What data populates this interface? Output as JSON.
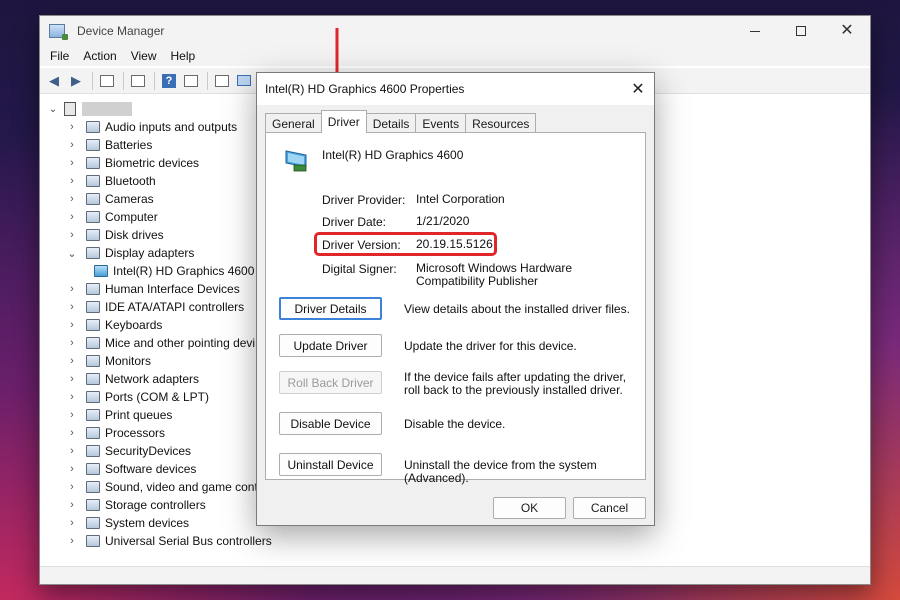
{
  "device_manager": {
    "title": "Device Manager",
    "menu": [
      "File",
      "Action",
      "View",
      "Help"
    ],
    "toolbar_icons": [
      "back-icon",
      "forward-icon",
      "properties-icon",
      "refresh-icon",
      "help-icon",
      "display-icon",
      "update-driver-icon",
      "monitor-icon"
    ],
    "tree": {
      "categories": [
        {
          "label": "Audio inputs and outputs",
          "icon": "speaker-icon"
        },
        {
          "label": "Batteries",
          "icon": "battery-icon"
        },
        {
          "label": "Biometric devices",
          "icon": "fingerprint-icon"
        },
        {
          "label": "Bluetooth",
          "icon": "bluetooth-icon"
        },
        {
          "label": "Cameras",
          "icon": "camera-icon"
        },
        {
          "label": "Computer",
          "icon": "computer-icon"
        },
        {
          "label": "Disk drives",
          "icon": "disk-icon"
        },
        {
          "label": "Display adapters",
          "icon": "display-adapter-icon",
          "expanded": true
        },
        {
          "label": "Human Interface Devices",
          "icon": "hid-icon"
        },
        {
          "label": "IDE ATA/ATAPI controllers",
          "icon": "ide-icon"
        },
        {
          "label": "Keyboards",
          "icon": "keyboard-icon"
        },
        {
          "label": "Mice and other pointing devi",
          "icon": "mouse-icon"
        },
        {
          "label": "Monitors",
          "icon": "monitor-icon"
        },
        {
          "label": "Network adapters",
          "icon": "network-icon"
        },
        {
          "label": "Ports (COM & LPT)",
          "icon": "port-icon"
        },
        {
          "label": "Print queues",
          "icon": "printer-icon"
        },
        {
          "label": "Processors",
          "icon": "cpu-icon"
        },
        {
          "label": "SecurityDevices",
          "icon": "security-icon"
        },
        {
          "label": "Software devices",
          "icon": "software-icon"
        },
        {
          "label": "Sound, video and game cont",
          "icon": "sound-icon"
        },
        {
          "label": "Storage controllers",
          "icon": "storage-icon"
        },
        {
          "label": "System devices",
          "icon": "system-icon"
        },
        {
          "label": "Universal Serial Bus controllers",
          "icon": "usb-icon"
        }
      ],
      "child": "Intel(R) HD Graphics 4600"
    }
  },
  "dialog": {
    "title": "Intel(R) HD Graphics 4600 Properties",
    "tabs": [
      "General",
      "Driver",
      "Details",
      "Events",
      "Resources"
    ],
    "active_tab": "Driver",
    "device_name": "Intel(R) HD Graphics 4600",
    "info": {
      "provider_label": "Driver Provider:",
      "provider_value": "Intel Corporation",
      "date_label": "Driver Date:",
      "date_value": "1/21/2020",
      "version_label": "Driver Version:",
      "version_value": "20.19.15.5126",
      "signer_label": "Digital Signer:",
      "signer_value": "Microsoft Windows Hardware Compatibility Publisher"
    },
    "actions": {
      "details_label": "Driver Details",
      "details_desc": "View details about the installed driver files.",
      "update_label": "Update Driver",
      "update_desc": "Update the driver for this device.",
      "rollback_label": "Roll Back Driver",
      "rollback_desc": "If the device fails after updating the driver, roll back to the previously installed driver.",
      "disable_label": "Disable Device",
      "disable_desc": "Disable the device.",
      "uninstall_label": "Uninstall Device",
      "uninstall_desc": "Uninstall the device from the system (Advanced)."
    },
    "ok_label": "OK",
    "cancel_label": "Cancel"
  },
  "colors": {
    "highlight": "#e0262b",
    "focus_border": "#3b82d8"
  }
}
